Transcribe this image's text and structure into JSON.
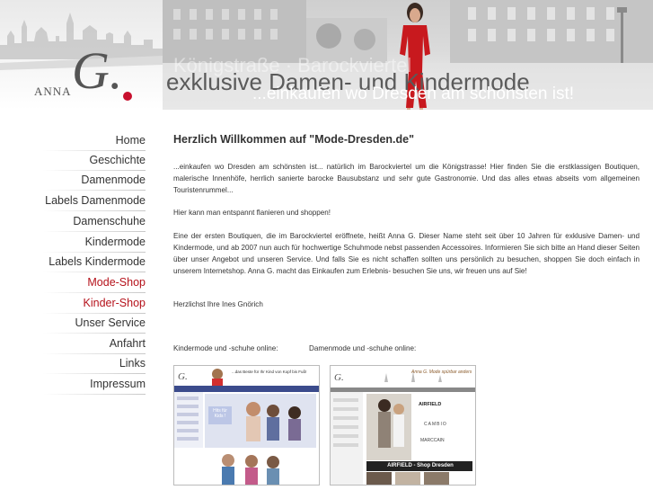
{
  "header": {
    "logo_initial": "G.",
    "logo_name": "ANNA",
    "ghost_text": "Königstraße · Barockviertel",
    "headline": "exklusive Damen- und Kindermode",
    "tagline": "...einkaufen wo Dresden am schönsten ist!"
  },
  "nav": {
    "items": [
      {
        "label": "Home"
      },
      {
        "label": "Geschichte"
      },
      {
        "label": "Damenmode"
      },
      {
        "label": "Labels Damenmode"
      },
      {
        "label": "Damenschuhe"
      },
      {
        "label": "Kindermode"
      },
      {
        "label": "Labels Kindermode"
      },
      {
        "label": "Mode-Shop"
      },
      {
        "label": "Kinder-Shop"
      },
      {
        "label": "Unser Service"
      },
      {
        "label": "Anfahrt"
      },
      {
        "label": "Links"
      },
      {
        "label": "Impressum"
      }
    ],
    "highlight_color": "#b5121b"
  },
  "content": {
    "title": "Herzlich Willkommen auf \"Mode-Dresden.de\"",
    "p1": "...einkaufen wo Dresden am schönsten ist... natürlich im Barockviertel um die Königstrasse! Hier finden Sie die erstklassigen Boutiquen, malerische Innenhöfe, herrlich sanierte barocke Bausubstanz und sehr gute Gastronomie. Und das alles etwas abseits vom allgemeinen Touristenrummel...",
    "p2": "Hier kann man entspannt flanieren und shoppen!",
    "p3": "Eine der ersten Boutiquen, die im Barockviertel eröffnete, heißt Anna G. Dieser Name steht seit über 10 Jahren für exklusive Damen- und Kindermode, und ab 2007 nun auch für hochwertige Schuhmode nebst passenden Accessoires. Informieren Sie sich bitte an Hand dieser Seiten über unser Angebot und unseren Service. Und falls Sie es nicht schaffen sollten uns persönlich zu besuchen, shoppen Sie doch einfach in unserem Internetshop. Anna G. macht das Einkaufen zum Erlebnis- besuchen Sie uns, wir freuen uns auf Sie!",
    "p4": "Herzlichst Ihre Ines Gnörich",
    "kids_label": "Kindermode und -schuhe online:",
    "women_label": "Damenmode und -schuhe online:"
  },
  "thumbs": {
    "kids_slogan": "...das Beste für Ihr Kind von Kopf bis Fuß!",
    "kids_badge": "Hits für Kids !",
    "women_slogan": "Anna G. Mode spürbar anders",
    "women_brand1": "AIRFIELD",
    "women_brand2": "CAMBIO",
    "women_brand3": "MARCCAIN",
    "women_shop": "AIRFIELD - Shop Dresden"
  }
}
